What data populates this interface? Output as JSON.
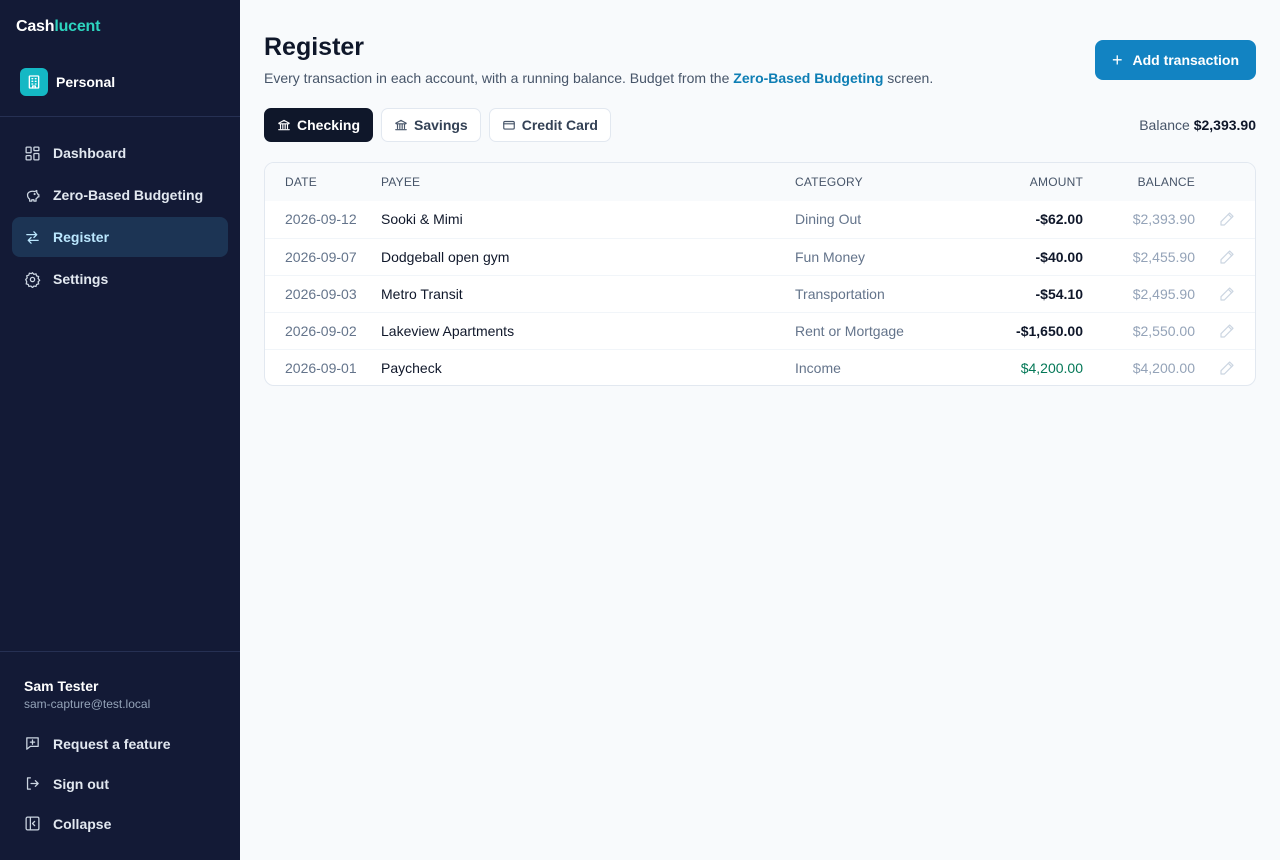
{
  "brand": {
    "part1": "Cash",
    "part2": "lucent"
  },
  "workspace": {
    "label": "Personal"
  },
  "nav": [
    {
      "label": "Dashboard",
      "icon": "dashboard-icon"
    },
    {
      "label": "Zero-Based Budgeting",
      "icon": "piggy-bank-icon"
    },
    {
      "label": "Register",
      "icon": "arrows-exchange-icon",
      "active": true
    },
    {
      "label": "Settings",
      "icon": "gear-icon"
    }
  ],
  "user": {
    "name": "Sam Tester",
    "email": "sam-capture@test.local"
  },
  "footer": {
    "request_feature": "Request a feature",
    "sign_out": "Sign out",
    "collapse": "Collapse"
  },
  "header": {
    "title": "Register",
    "subtitle_before": "Every transaction in each account, with a running balance. Budget from the ",
    "subtitle_link": "Zero-Based Budgeting",
    "subtitle_after": " screen.",
    "add_label": "Add transaction"
  },
  "accounts": [
    {
      "label": "Checking",
      "icon": "bank-icon",
      "active": true
    },
    {
      "label": "Savings",
      "icon": "bank-icon"
    },
    {
      "label": "Credit Card",
      "icon": "credit-card-icon"
    }
  ],
  "balance": {
    "label": "Balance",
    "value": "$2,393.90"
  },
  "table": {
    "headers": {
      "date": "DATE",
      "payee": "PAYEE",
      "category": "CATEGORY",
      "amount": "AMOUNT",
      "balance": "BALANCE"
    },
    "rows": [
      {
        "date": "2026-09-12",
        "payee": "Sooki & Mimi",
        "category": "Dining Out",
        "amount": "-$62.00",
        "balance": "$2,393.90"
      },
      {
        "date": "2026-09-07",
        "payee": "Dodgeball open gym",
        "category": "Fun Money",
        "amount": "-$40.00",
        "balance": "$2,455.90"
      },
      {
        "date": "2026-09-03",
        "payee": "Metro Transit",
        "category": "Transportation",
        "amount": "-$54.10",
        "balance": "$2,495.90"
      },
      {
        "date": "2026-09-02",
        "payee": "Lakeview Apartments",
        "category": "Rent or Mortgage",
        "amount": "-$1,650.00",
        "balance": "$2,550.00"
      },
      {
        "date": "2026-09-01",
        "payee": "Paycheck",
        "category": "Income",
        "amount": "$4,200.00",
        "balance": "$4,200.00"
      }
    ]
  },
  "colors": {
    "sidebar": "#131a36",
    "accent": "#1283c2",
    "brand_accent": "#2dd4bf",
    "positive": "#047857"
  }
}
